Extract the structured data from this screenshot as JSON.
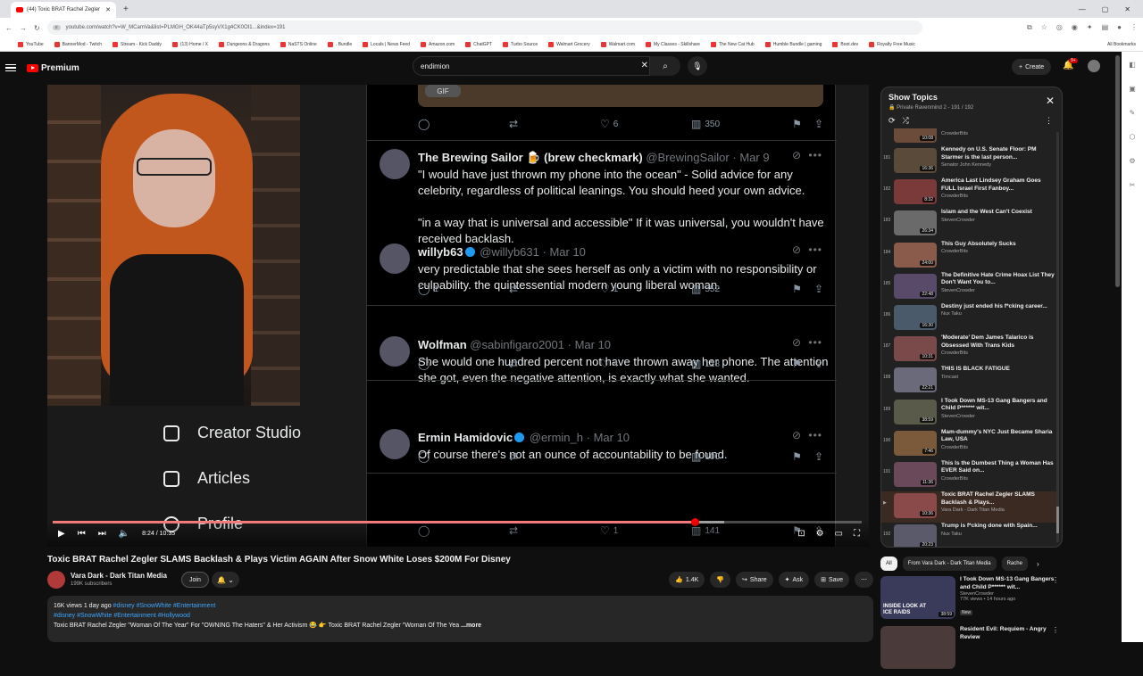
{
  "browser": {
    "tab_title": "(44) Toxic BRAT Rachel Zegler",
    "new_tab": "+",
    "url": "youtube.com/watch?v=W_MCamVa&list=PLMGH_OK44aTp5syVX1g4CK0OI1...&index=191",
    "bookmarks": [
      "YouTube",
      "BannerMod - Twitch",
      "Stream - Kick Daddy",
      "(13) Home / X",
      "Dungeons & Dragons",
      "NaSTS Online ",
      ". Bundle",
      "Locals | News Feed",
      "Amazon.com",
      "ChatGPT",
      "Turbo Source",
      "Walmart Grocery",
      "Walmart.com",
      "My Classes - Skillshare",
      "The New Cat Hub",
      "Humble Bundle | gaming",
      "Boot.dev",
      "Royalty Free Music"
    ],
    "all_bookmarks": "All Bookmarks"
  },
  "yt": {
    "logo": "Premium",
    "search_value": "endimion",
    "create_label": "Create",
    "notif_count": "9+"
  },
  "x_nav": {
    "items": [
      "Creator Studio",
      "Articles",
      "Profile"
    ]
  },
  "feed": {
    "gif_label": "GIF",
    "top_actions": {
      "replies": "",
      "retweets": "",
      "likes": "6",
      "views": "350"
    },
    "tweets": [
      {
        "name": "The Brewing Sailor 🍺 (brew checkmark)",
        "handle": "@BrewingSailor",
        "date": "Mar 9",
        "verified": false,
        "body": "\"I would have just thrown my phone into the ocean\" - Solid advice for any celebrity, regardless of political leanings. You should heed your own advice.",
        "body2": "\"in a way that is universal and accessible\" If it was universal, you wouldn't have received backlash.",
        "replies": "1",
        "retweets": "",
        "likes": "1",
        "views": "552"
      },
      {
        "name": "willyb63",
        "handle": "@willyb631",
        "date": "Mar 10",
        "verified": true,
        "body": "very predictable that she sees herself as only a victim with no responsibility or culpability.  the quintessential modern young liberal woman.",
        "body2": "",
        "replies": "",
        "retweets": "",
        "likes": "4",
        "views": "128"
      },
      {
        "name": "Wolfman",
        "handle": "@sabinfigaro2001",
        "date": "Mar 10",
        "verified": false,
        "body": "She would one hundred percent not have thrown away her phone. The attention she got, even the negative attention, is exactly what she wanted.",
        "body2": "",
        "replies": "",
        "retweets": "",
        "likes": "",
        "views": "100"
      },
      {
        "name": "Ermin Hamidovic",
        "handle": "@ermin_h",
        "date": "Mar 10",
        "verified": true,
        "body": "Of course there's not an ounce of accountability to be found.",
        "body2": "",
        "replies": "",
        "retweets": "",
        "likes": "1",
        "views": "141"
      }
    ]
  },
  "player": {
    "time": "8:24 / 10:35",
    "progress_pct": 79.4
  },
  "video": {
    "title": "Toxic BRAT Rachel Zegler SLAMS Backlash & Plays Victim AGAIN After Snow White Loses $200M For Disney",
    "channel": "Vara Dark - Dark Titan Media",
    "subs": "199K subscribers",
    "join": "Join",
    "likes": "1.4K",
    "share": "Share",
    "ask": "Ask",
    "save": "Save",
    "desc_line1_a": "16K views  1 day ago  ",
    "desc_line1_tags": "#disney #SnowWhite #Entertainment",
    "desc_line2": "#disney #SnowWhite #Entertainment #Hollywood",
    "desc_line3": "Toxic BRAT Rachel Zegler \"Woman Of The Year\" For \"OWNING The Haters\" & Her Activism 😂 👉 Toxic BRAT Rachel Zegler \"Woman Of The Yea",
    "more": "...more"
  },
  "playlist": {
    "title": "Show Topics",
    "sub": "Private Ravenmind 2 - 191 / 192",
    "items": [
      {
        "num": "",
        "title": "",
        "channel": "CrowderBits",
        "dur": "10:08"
      },
      {
        "num": "181",
        "title": "Kennedy on U.S. Senate Floor: PM Starmer is the last person...",
        "channel": "Senator John Kennedy",
        "dur": "16:36"
      },
      {
        "num": "182",
        "title": "America Last Lindsey Graham Goes FULL Israel First Fanboy...",
        "channel": "CrowderBits",
        "dur": "8:32"
      },
      {
        "num": "183",
        "title": "Islam and the West Can't Coexist",
        "channel": "StevenCrowder",
        "dur": "26:34"
      },
      {
        "num": "184",
        "title": "This Guy Absolutely Sucks",
        "channel": "CrowderBits",
        "dur": "24:00"
      },
      {
        "num": "185",
        "title": "The Definitive Hate Crime Hoax List They Don't Want You to...",
        "channel": "StevenCrowder",
        "dur": "22:48"
      },
      {
        "num": "186",
        "title": "Destiny just ended his f*cking career...",
        "channel": "Nux Taku",
        "dur": "16:30"
      },
      {
        "num": "187",
        "title": "'Moderate' Dem James Talarico is Obsessed With Trans Kids",
        "channel": "CrowderBits",
        "dur": "10:31"
      },
      {
        "num": "188",
        "title": "THIS IS BLACK FATIGUE",
        "channel": "Timcast",
        "dur": "22:21"
      },
      {
        "num": "189",
        "title": "I Took Down MS-13 Gang Bangers and Child P****** wit...",
        "channel": "StevenCrowder",
        "dur": "38:59"
      },
      {
        "num": "190",
        "title": "Mam-dummy's NYC Just Became Sharia Law, USA",
        "channel": "CrowderBits",
        "dur": "7:46"
      },
      {
        "num": "191",
        "title": "This Is the Dumbest Thing a Woman Has EVER Said on...",
        "channel": "CrowderBits",
        "dur": "11:36"
      },
      {
        "num": "▶",
        "title": "Toxic BRAT Rachel Zegler SLAMS Backlash & Plays...",
        "channel": "Vara Dark - Dark Titan Media",
        "dur": "10:36"
      },
      {
        "num": "192",
        "title": "Trump is f*cking done with Spain...",
        "channel": "Nux Taku",
        "dur": "20:23"
      }
    ]
  },
  "chips": [
    "All",
    "From Vara Dark - Dark Titan Media",
    "Rache"
  ],
  "recs": [
    {
      "title": "I Took Down MS-13 Gang Bangers and Child P****** wit...",
      "channel": "StevenCrowder",
      "meta": "77K views • 14 hours ago",
      "badge": "New",
      "dur": "38:59",
      "overlay": "INSIDE LOOK AT ICE RAIDS"
    },
    {
      "title": "Resident Evil: Requiem - Angry Review",
      "channel": "",
      "meta": "",
      "badge": "",
      "dur": "",
      "overlay": ""
    }
  ]
}
